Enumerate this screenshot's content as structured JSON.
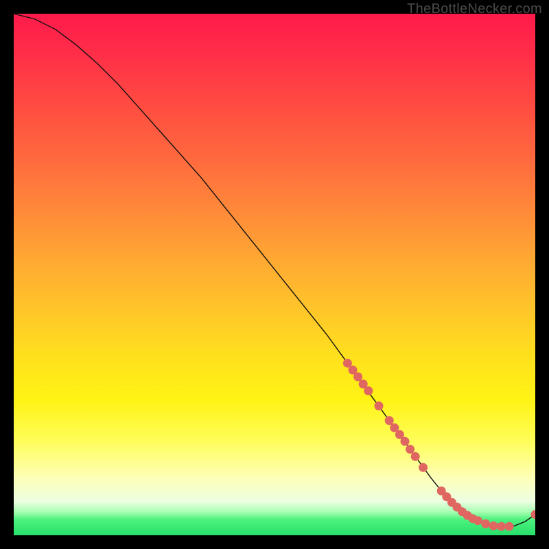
{
  "attribution": "TheBottleNecker.com",
  "chart_data": {
    "type": "line",
    "title": "",
    "xlabel": "",
    "ylabel": "",
    "xlim": [
      0,
      100
    ],
    "ylim": [
      0,
      100
    ],
    "curve": {
      "x": [
        0,
        4,
        8,
        12,
        16,
        20,
        24,
        28,
        32,
        36,
        40,
        44,
        48,
        52,
        56,
        60,
        64,
        68,
        72,
        76,
        80,
        82,
        84,
        86,
        88,
        90,
        92,
        94,
        96,
        98,
        100
      ],
      "y": [
        100,
        99,
        97,
        94,
        90.5,
        86.5,
        82,
        77.5,
        73,
        68.5,
        63.5,
        58.5,
        53.5,
        48.5,
        43.5,
        38.5,
        33,
        27.5,
        22,
        16.5,
        11,
        8.5,
        6.3,
        4.5,
        3.2,
        2.3,
        1.8,
        1.6,
        1.8,
        2.6,
        4.0
      ]
    },
    "markers": [
      {
        "x": 64.0,
        "y": 33.0
      },
      {
        "x": 65.0,
        "y": 31.7
      },
      {
        "x": 66.0,
        "y": 30.4
      },
      {
        "x": 67.0,
        "y": 29.0
      },
      {
        "x": 68.0,
        "y": 27.7
      },
      {
        "x": 70.0,
        "y": 24.8
      },
      {
        "x": 72.0,
        "y": 22.0
      },
      {
        "x": 73.0,
        "y": 20.6
      },
      {
        "x": 74.0,
        "y": 19.3
      },
      {
        "x": 75.0,
        "y": 18.0
      },
      {
        "x": 76.0,
        "y": 16.5
      },
      {
        "x": 77.0,
        "y": 15.1
      },
      {
        "x": 78.5,
        "y": 13.0
      },
      {
        "x": 82.0,
        "y": 8.5
      },
      {
        "x": 83.0,
        "y": 7.4
      },
      {
        "x": 84.0,
        "y": 6.3
      },
      {
        "x": 85.0,
        "y": 5.4
      },
      {
        "x": 86.0,
        "y": 4.5
      },
      {
        "x": 87.0,
        "y": 3.8
      },
      {
        "x": 88.0,
        "y": 3.2
      },
      {
        "x": 89.0,
        "y": 2.8
      },
      {
        "x": 90.5,
        "y": 2.2
      },
      {
        "x": 92.0,
        "y": 1.8
      },
      {
        "x": 93.5,
        "y": 1.7
      },
      {
        "x": 95.0,
        "y": 1.7
      },
      {
        "x": 100.0,
        "y": 4.0
      }
    ]
  }
}
